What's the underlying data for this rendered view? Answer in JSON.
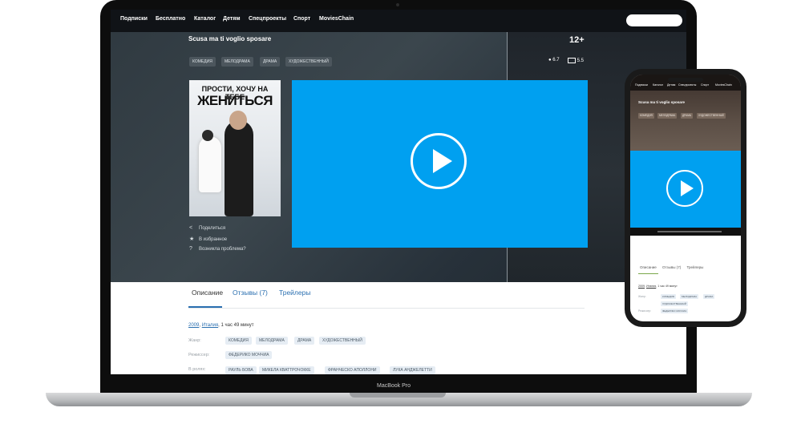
{
  "laptop": {
    "brand": "MacBook Pro",
    "nav": [
      "Подписки",
      "Бесплатно",
      "Каталог",
      "Детям",
      "Спецпроекты",
      "Спорт",
      "MoviesChain"
    ],
    "movie_title": "Scusa ma ti voglio sposare",
    "age_rating": "12+",
    "genres": [
      "КОМЕДИЯ",
      "МЕЛОДРАМА",
      "ДРАМА",
      "ХУДОЖЕСТВЕННЫЙ"
    ],
    "ratings": {
      "kp": "6.7",
      "imdb": "5.5"
    },
    "poster": {
      "line1": "ПРОСТИ, ХОЧУ НА ТЕБЕ",
      "line2": "ЖЕНИТЬСЯ"
    },
    "actions": [
      {
        "icon": "share-icon",
        "label": "Поделиться"
      },
      {
        "icon": "star-icon",
        "label": "В избранное"
      },
      {
        "icon": "question-icon",
        "label": "Возникла проблема?"
      }
    ],
    "tabs": [
      "Описание",
      "Отзывы (7)",
      "Трейлеры"
    ],
    "meta": {
      "year": "2009",
      "country": "Италия",
      "duration": "1 час 49 минут"
    },
    "genre_label": "Жанр:",
    "genre_pills": [
      "КОМЕДИЯ",
      "МЕЛОДРАМА",
      "ДРАМА",
      "ХУДОЖЕСТВЕННЫЙ"
    ],
    "director_label": "Режиссер:",
    "director": "ФЕДЕРИКО МОЧЧИА",
    "cast_label": "В ролях:",
    "cast": [
      "РАУЛЬ БОВА",
      "МИКЕЛА КВАТТРОЧОККЕ",
      "ФРАНЧЕСКО АПОЛЛОНИ",
      "ЛУКА АНДЖЕЛЕТТИ"
    ]
  },
  "phone": {
    "nav": [
      "Подписки",
      "Каталог",
      "Детям",
      "Спецпроекты",
      "Спорт",
      "MoviesChain"
    ],
    "movie_title": "Scusa ma ti voglio sposare",
    "genres": [
      "КОМЕДИЯ",
      "МЕЛОДРАМА",
      "ДРАМА",
      "ХУДОЖЕСТВЕННЫЙ"
    ],
    "tabs": [
      "Описание",
      "Отзывы (7)",
      "Трейлеры"
    ],
    "meta": {
      "year": "2009",
      "country": "Италия",
      "duration": "1 час 49 минут"
    },
    "genre_label": "Жанр:",
    "genre_pills": [
      "КОМЕДИЯ",
      "МЕЛОДРАМА",
      "ДРАМА",
      "ХУДОЖЕСТВЕННЫЙ"
    ],
    "director_label": "Режиссер:",
    "director": "ФЕДЕРИКО МОЧЧИА"
  },
  "colors": {
    "accent": "#00a0f0",
    "link": "#2a6fb0",
    "hero": "#2f3940"
  }
}
